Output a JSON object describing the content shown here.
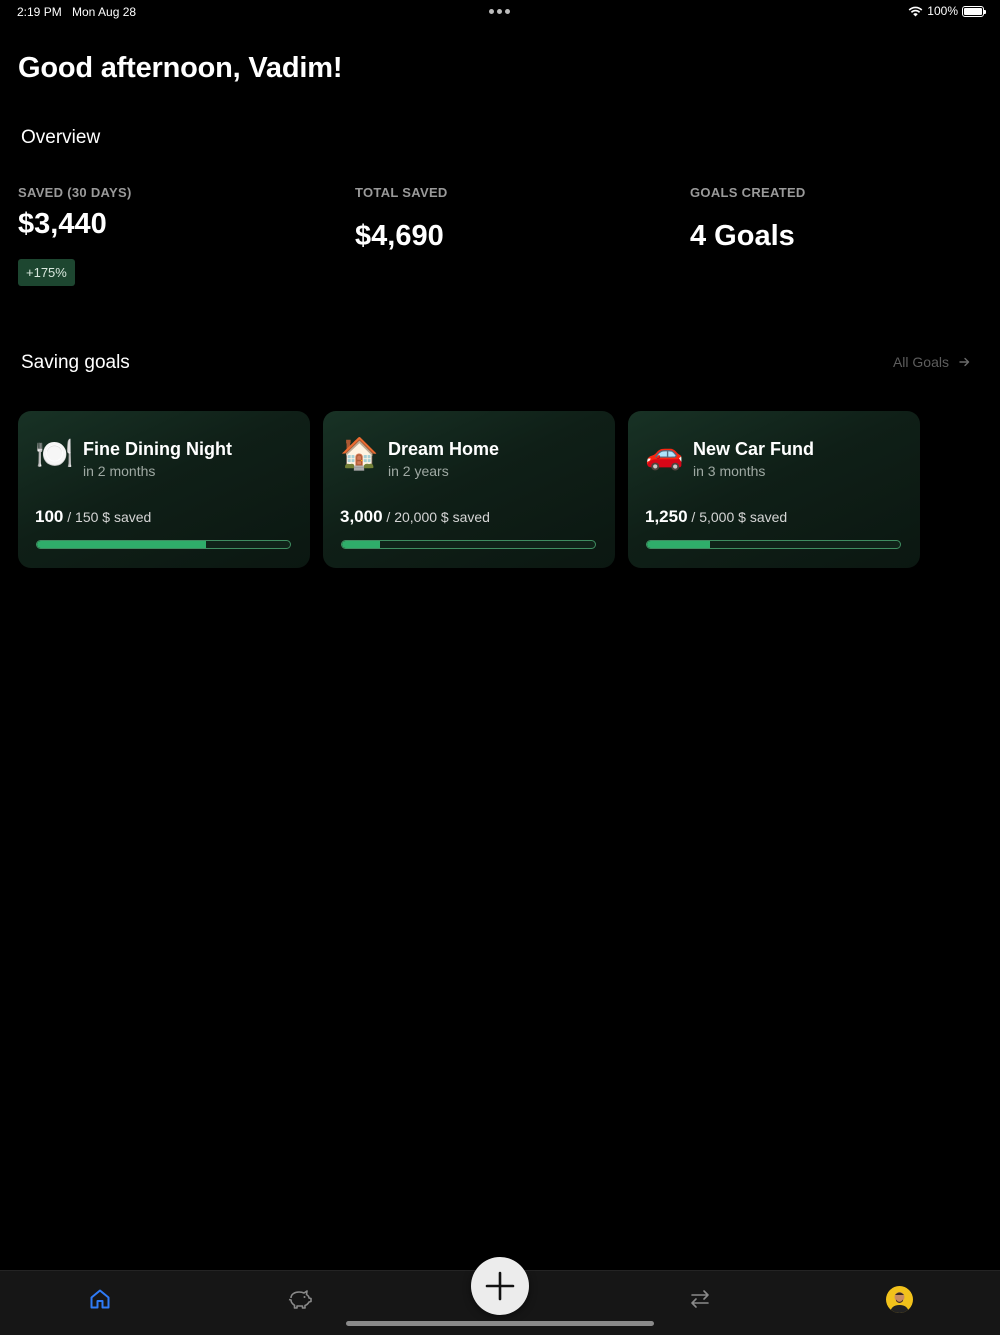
{
  "status_bar": {
    "time": "2:19 PM",
    "date": "Mon Aug 28",
    "battery": "100%"
  },
  "greeting": "Good afternoon, Vadim!",
  "overview": {
    "title": "Overview",
    "stats": [
      {
        "label": "SAVED (30 DAYS)",
        "value": "$3,440"
      },
      {
        "label": "TOTAL SAVED",
        "value": "$4,690"
      },
      {
        "label": "GOALS CREATED",
        "value": "4 Goals"
      }
    ],
    "change_badge": "+175%"
  },
  "saving_goals": {
    "title": "Saving goals",
    "all_goals_label": "All Goals",
    "goals": [
      {
        "icon": "🍽️",
        "icon_name": "plate-cutlery-icon",
        "title": "Fine Dining Night",
        "subtitle": "in 2 months",
        "saved": "100",
        "target_text": " / 150 $ saved",
        "progress": 0.667
      },
      {
        "icon": "🏠",
        "icon_name": "house-icon",
        "title": "Dream Home",
        "subtitle": "in 2 years",
        "saved": "3,000",
        "target_text": " / 20,000 $ saved",
        "progress": 0.15
      },
      {
        "icon": "🚗",
        "icon_name": "car-icon",
        "title": "New Car Fund",
        "subtitle": "in 3 months",
        "saved": "1,250",
        "target_text": " / 5,000 $ saved",
        "progress": 0.25
      }
    ]
  },
  "tab_bar": {
    "tabs": [
      "home-icon",
      "piggy-bank-icon",
      "transfer-icon",
      "profile-avatar"
    ],
    "active": "home-icon",
    "accent_color": "#2f7bf6"
  },
  "colors": {
    "background": "#000000",
    "progress_fill": "#2fad6a",
    "badge_bg": "#1d4630"
  }
}
